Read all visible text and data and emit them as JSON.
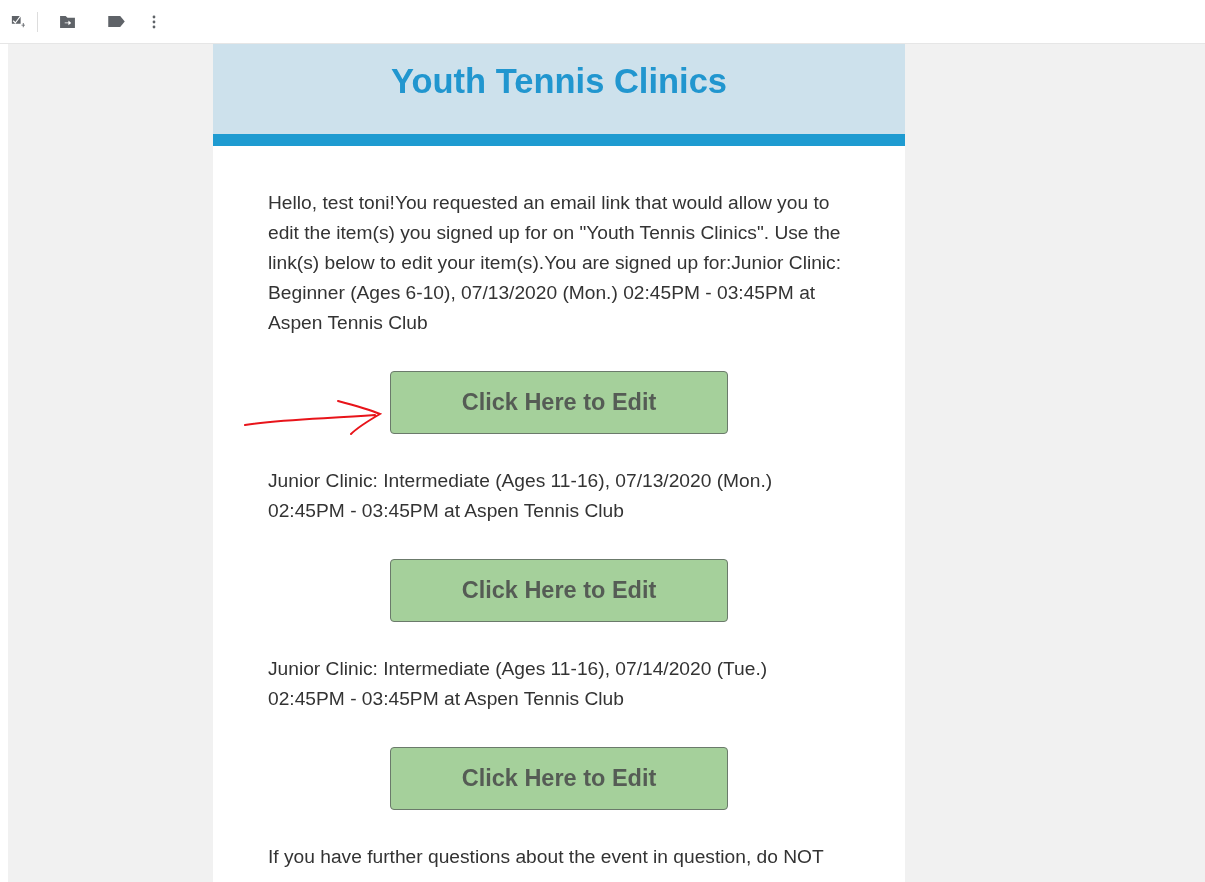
{
  "header": {
    "title": "Youth Tennis Clinics"
  },
  "blocks": [
    {
      "text": "Hello, test toni!You requested an email link that would allow you to edit the item(s) you signed up for on \"Youth Tennis Clinics\". Use the link(s) below to edit your item(s).You are signed up for:Junior Clinic: Beginner (Ages 6-10), 07/13/2020 (Mon.) 02:45PM - 03:45PM at Aspen Tennis Club",
      "button": "Click Here to Edit",
      "arrow": true
    },
    {
      "text": "Junior Clinic: Intermediate (Ages 11-16), 07/13/2020 (Mon.) 02:45PM - 03:45PM at Aspen Tennis Club",
      "button": "Click Here to Edit",
      "arrow": false
    },
    {
      "text": "Junior Clinic: Intermediate (Ages 11-16), 07/14/2020 (Tue.) 02:45PM - 03:45PM at Aspen Tennis Club",
      "button": "Click Here to Edit",
      "arrow": false
    }
  ],
  "footer": "If you have further questions about the event in question, do NOT"
}
